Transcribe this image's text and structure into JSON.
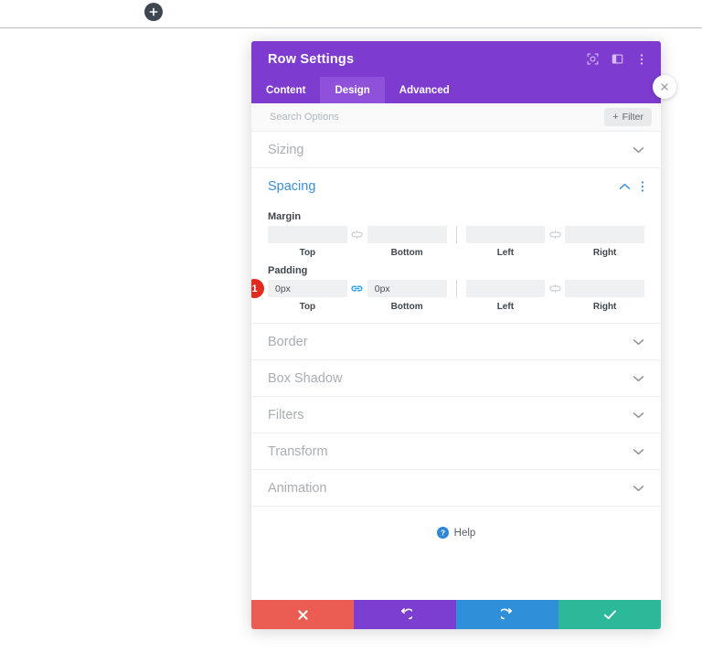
{
  "page": {
    "add_section_icon": "plus-icon"
  },
  "panel": {
    "title": "Row Settings",
    "header_icons": [
      {
        "name": "focus-target-icon"
      },
      {
        "name": "panel-layout-icon"
      },
      {
        "name": "kebab-menu-icon"
      }
    ],
    "close_icon": "close-icon",
    "tabs": [
      {
        "label": "Content",
        "active": false
      },
      {
        "label": "Design",
        "active": true
      },
      {
        "label": "Advanced",
        "active": false
      }
    ],
    "search": {
      "placeholder": "Search Options",
      "value": ""
    },
    "filter": {
      "label": "Filter",
      "plus": "+"
    },
    "sections": [
      {
        "label": "Sizing",
        "state": "collapsed",
        "icon": "chevron-down-icon"
      },
      {
        "label": "Spacing",
        "state": "expanded",
        "icon": "chevron-up-icon"
      },
      {
        "label": "Border",
        "state": "collapsed",
        "icon": "chevron-down-icon"
      },
      {
        "label": "Box Shadow",
        "state": "collapsed",
        "icon": "chevron-down-icon"
      },
      {
        "label": "Filters",
        "state": "collapsed",
        "icon": "chevron-down-icon"
      },
      {
        "label": "Transform",
        "state": "collapsed",
        "icon": "chevron-down-icon"
      },
      {
        "label": "Animation",
        "state": "collapsed",
        "icon": "chevron-down-icon"
      }
    ],
    "spacing": {
      "title": "Spacing",
      "collapse_icon": "chevron-up-icon",
      "options_icon": "kebab-menu-icon",
      "margin": {
        "label": "Margin",
        "top": {
          "caption": "Top",
          "value": ""
        },
        "bottom": {
          "caption": "Bottom",
          "value": ""
        },
        "left": {
          "caption": "Left",
          "value": ""
        },
        "right": {
          "caption": "Right",
          "value": ""
        },
        "link_vertical": "broken-link-icon",
        "link_horizontal": "broken-link-icon"
      },
      "padding": {
        "label": "Padding",
        "badge": "1",
        "top": {
          "caption": "Top",
          "value": "0px"
        },
        "bottom": {
          "caption": "Bottom",
          "value": "0px"
        },
        "left": {
          "caption": "Left",
          "value": ""
        },
        "right": {
          "caption": "Right",
          "value": ""
        },
        "link_vertical": "linked-chain-icon",
        "link_horizontal": "broken-link-icon"
      }
    },
    "help": {
      "label": "Help",
      "icon": "question-circle-icon"
    },
    "footer": [
      {
        "name": "cancel-button",
        "icon": "x-icon"
      },
      {
        "name": "undo-button",
        "icon": "undo-arrow-icon"
      },
      {
        "name": "redo-button",
        "icon": "redo-arrow-icon"
      },
      {
        "name": "save-button",
        "icon": "check-icon"
      }
    ]
  },
  "colors": {
    "header_purple": "#7e3bd0",
    "tab_active_purple": "#8f51da",
    "accent_blue": "#3b8fd4",
    "link_active_blue": "#2ea3f2",
    "badge_red": "#e02b20",
    "cancel_red": "#eb5d52",
    "undo_purple": "#7b3ed0",
    "redo_blue": "#2f8fd8",
    "save_green": "#2bb99a"
  }
}
